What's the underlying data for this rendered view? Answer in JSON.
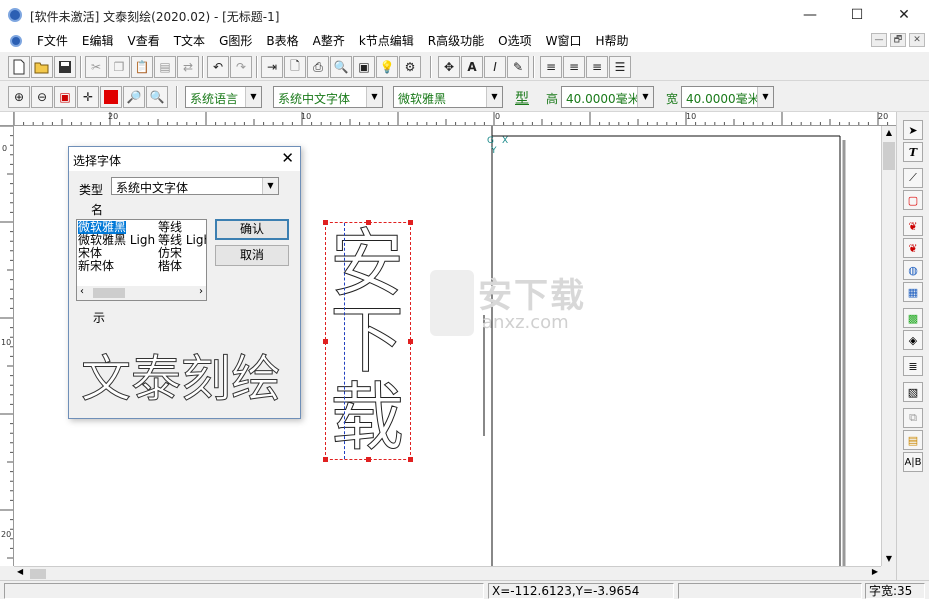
{
  "window": {
    "title": "[软件未激活] 文泰刻绘(2020.02) - [无标题-1]",
    "minimize": "—",
    "maximize": "☐",
    "close": "✕"
  },
  "menu": {
    "items": [
      "F文件",
      "E编辑",
      "V查看",
      "T文本",
      "G图形",
      "B表格",
      "A整齐",
      "k节点编辑",
      "R高级功能",
      "O选项",
      "W窗口",
      "H帮助"
    ],
    "mdi_buttons": [
      "—",
      "🗗",
      "✕"
    ]
  },
  "toolbar2": {
    "lang_combo": "系统语言",
    "charset_combo": "系统中文字体",
    "font_combo": "微软雅黑",
    "type_label": "型",
    "height_label": "高",
    "height_value": "40.0000毫米",
    "width_label": "宽",
    "width_value": "40.0000毫米"
  },
  "ruler": {
    "h_labels": [
      "20",
      "10",
      "0",
      "10",
      "20"
    ],
    "v_labels": [
      "0",
      "10",
      "20"
    ]
  },
  "canvas": {
    "vertical_text": [
      "安",
      "下",
      "载"
    ],
    "origin_label_g": "G",
    "origin_label_x": "X",
    "origin_label_y": "Y",
    "watermark_brand": "安下载",
    "watermark_domain": "anxz.com"
  },
  "dialog": {
    "title": "选择字体",
    "close": "✕",
    "type_label": "类型",
    "type_value": "系统中文字体",
    "name_label": "名",
    "font_rows": [
      {
        "name": "微软雅黑",
        "alt": "等线"
      },
      {
        "name": "微软雅黑 Ligh",
        "alt": "等线 Ligh"
      },
      {
        "name": "宋体",
        "alt": "仿宋"
      },
      {
        "name": "新宋体",
        "alt": "楷体"
      }
    ],
    "ok_label": "确认",
    "cancel_label": "取消",
    "show_label": "示",
    "preview_text": "文泰刻绘"
  },
  "statusbar": {
    "coords": "X=-112.6123,Y=-3.9654",
    "char_width": "字宽:35"
  },
  "colors": {
    "accent_green": "#1a7a1a",
    "selection_blue": "#0078d7",
    "handle_red": "#e02020"
  }
}
